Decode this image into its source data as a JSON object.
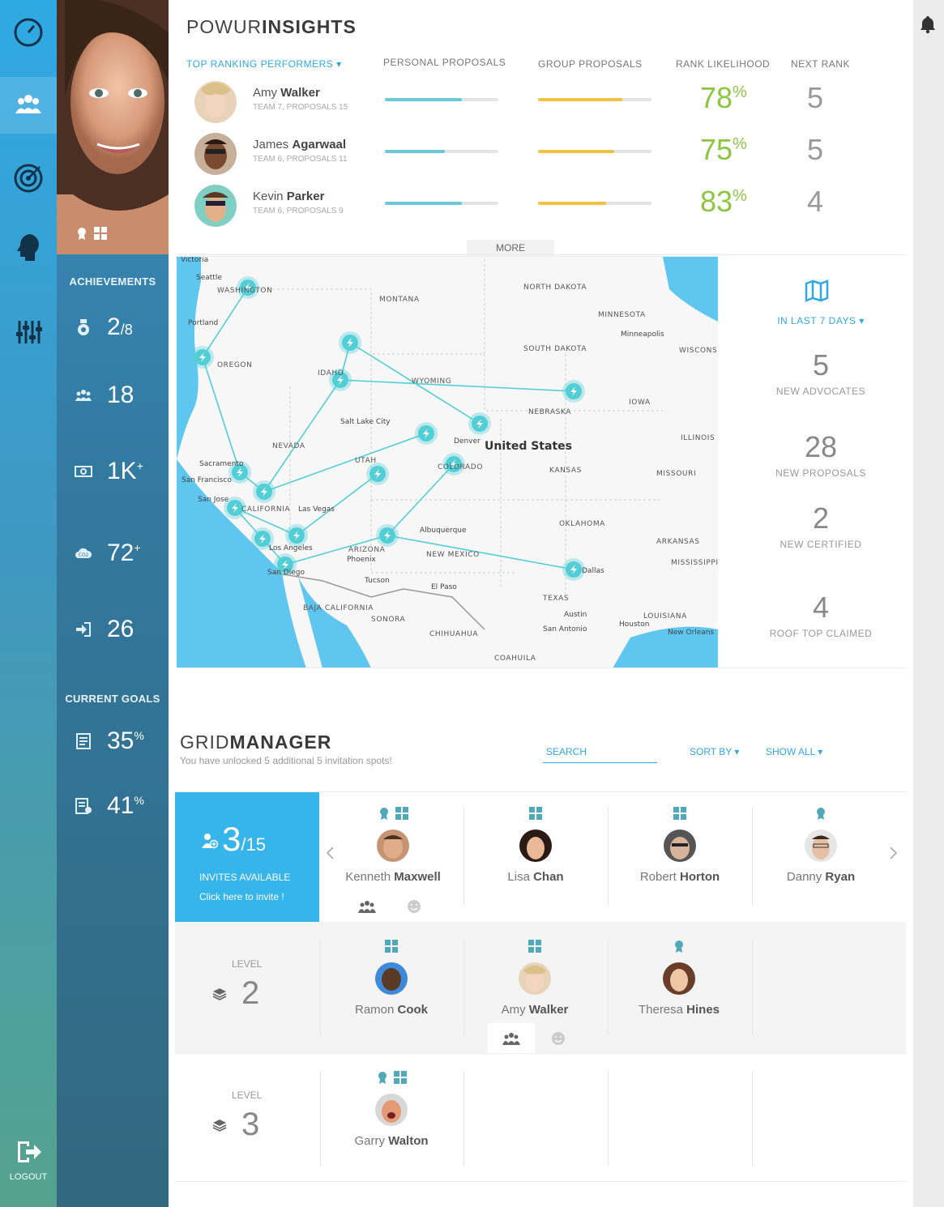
{
  "insights": {
    "title_light": "POWUR",
    "title_bold": "INSIGHTS",
    "filter_label": "TOP RANKING PERFORMERS ▾",
    "col_personal": "PERSONAL PROPOSALS",
    "col_group": "GROUP  PROPOSALS",
    "col_rank": "RANK  LIKELIHOOD",
    "col_next": "NEXT RANK",
    "more_label": "MORE",
    "performers": [
      {
        "first": "Amy",
        "last": "Walker",
        "sub": "TEAM 7, PROPOSALS 15",
        "personal": 0.68,
        "group": 0.74,
        "likelihood": "78",
        "next_rank": "5"
      },
      {
        "first": "James",
        "last": "Agarwaal",
        "sub": "TEAM 6, PROPOSALS 11",
        "personal": 0.53,
        "group": 0.67,
        "likelihood": "75",
        "next_rank": "5"
      },
      {
        "first": "Kevin",
        "last": "Parker",
        "sub": "TEAM 6, PROPOSALS 9",
        "personal": 0.68,
        "group": 0.6,
        "likelihood": "83",
        "next_rank": "4"
      }
    ],
    "pct_sign": "%",
    "colors": {
      "personal": "#6cc9d4",
      "group": "#f3c140",
      "likelihood": "#8cc63f"
    }
  },
  "map": {
    "country_label": "United States",
    "labels": [
      "Victoria",
      "Seattle",
      "WASHINGTON",
      "MONTANA",
      "NORTH DAKOTA",
      "MINNESOTA",
      "Minneapolis",
      "Portland",
      "OREGON",
      "IDAHO",
      "WYOMING",
      "SOUTH DAKOTA",
      "WISCONSIN",
      "IOWA",
      "NEBRASKA",
      "Salt Lake City",
      "NEVADA",
      "UTAH",
      "Denver",
      "COLORADO",
      "KANSAS",
      "ILLINOIS",
      "MISSOURI",
      "Sacramento",
      "San Francisco",
      "San Jose",
      "CALIFORNIA",
      "Las Vegas",
      "Los Angeles",
      "San Diego",
      "ARIZONA",
      "Phoenix",
      "Albuquerque",
      "NEW MEXICO",
      "OKLAHOMA",
      "ARKANSAS",
      "MISSISSIPPI",
      "Tucson",
      "El Paso",
      "TEXAS",
      "Dallas",
      "Austin",
      "San Antonio",
      "Houston",
      "LOUISIANA",
      "New Orleans",
      "BAJA CALIFORNIA",
      "SONORA",
      "CHIHUAHUA",
      "COAHUILA"
    ]
  },
  "stats": {
    "period": "IN LAST 7 DAYS ▾",
    "items": [
      {
        "value": "5",
        "label": "NEW ADVOCATES"
      },
      {
        "value": "28",
        "label": "NEW PROPOSALS"
      },
      {
        "value": "2",
        "label": "NEW CERTIFIED"
      },
      {
        "value": "4",
        "label": "ROOF TOP CLAIMED"
      }
    ]
  },
  "sidebar": {
    "achievements_title": "ACHIEVEMENTS",
    "goals_title": "CURRENT GOALS",
    "ach1_main": "2",
    "ach1_sub": "/8",
    "ach2": "18",
    "ach3_main": "1K",
    "ach3_sup": "+",
    "ach4_main": "72",
    "ach4_sup": "+",
    "ach5": "26",
    "goal1_main": "35",
    "goal1_sup": "%",
    "goal2_main": "41",
    "goal2_sup": "%",
    "logout_label": "LOGOUT",
    "icons": [
      "speedometer-icon",
      "team-icon",
      "target-icon",
      "head-icon",
      "sliders-icon"
    ]
  },
  "grid": {
    "title_light": "GRID",
    "title_bold": "MANAGER",
    "subtitle": "You have unlocked 5 additional 5 invitation spots!",
    "search_placeholder": "SEARCH",
    "sort_label": "SORT BY ▾",
    "show_label": "SHOW ALL ▾",
    "invites_count": "3",
    "invites_total": "/15",
    "invites_label": "INVITES AVAILABLE",
    "invite_link": "Click here to invite !",
    "level_label": "LEVEL",
    "level1": [
      {
        "first": "Kenneth",
        "last": "Maxwell"
      },
      {
        "first": "Lisa",
        "last": "Chan"
      },
      {
        "first": "Robert",
        "last": "Horton"
      },
      {
        "first": "Danny",
        "last": "Ryan"
      }
    ],
    "level2_num": "2",
    "level2": [
      {
        "first": "Ramon",
        "last": "Cook"
      },
      {
        "first": "Amy",
        "last": "Walker"
      },
      {
        "first": "Theresa",
        "last": "Hines"
      }
    ],
    "level3_num": "3",
    "level3": [
      {
        "first": "Garry",
        "last": "Walton"
      }
    ]
  }
}
